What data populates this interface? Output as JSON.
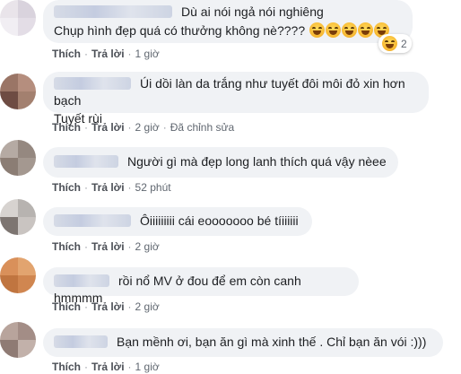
{
  "actions": {
    "like_label": "Thích",
    "reply_label": "Trả lời",
    "separator": "·"
  },
  "comments": [
    {
      "text": "Dù ai nói ngả nói nghiêng",
      "text2": "Chụp hình đẹp quá có thưởng không nè????",
      "emoji_icon": "laughing-emoji",
      "emoji_count": 5,
      "reaction_count": "2",
      "time": "1 giờ",
      "avatar_colors": [
        "#e9e4ea",
        "#d9d3dd",
        "#f1eef3",
        "#e3dde6"
      ]
    },
    {
      "text": "Úi dồi làn da trắng như tuyết đôi môi đỏ xin hơn bạch",
      "text2": "Tuyết rùi",
      "time": "2 giờ",
      "edited": "Đã chỉnh sửa",
      "avatar_colors": [
        "#9a7566",
        "#b58e7e",
        "#6e4c43",
        "#a3806f"
      ]
    },
    {
      "text": "Người gì mà đẹp long lanh thích quá vậy nèee",
      "time": "52 phút",
      "avatar_colors": [
        "#b5aaa3",
        "#958880",
        "#8b7d74",
        "#a49890"
      ]
    },
    {
      "text": "Ôiiiiiiiii cái eooooooo bé tíiiiiii",
      "time": "2 giờ",
      "avatar_colors": [
        "#d7d3d0",
        "#b7b3b0",
        "#7d7571",
        "#c9c4c1"
      ]
    },
    {
      "text": "rồi nổ MV ở đou để em còn canh hmmmm",
      "time": "2 giờ",
      "avatar_colors": [
        "#d9905a",
        "#e2a46f",
        "#c07540",
        "#d08650"
      ]
    },
    {
      "text": "Bạn mềnh ơi, bạn ăn gì mà xinh thế . Chỉ bạn ăn vói :)))",
      "time": "1 giờ",
      "avatar_colors": [
        "#b8a49c",
        "#a38d86",
        "#8f7b74",
        "#c2b1aa"
      ]
    }
  ]
}
